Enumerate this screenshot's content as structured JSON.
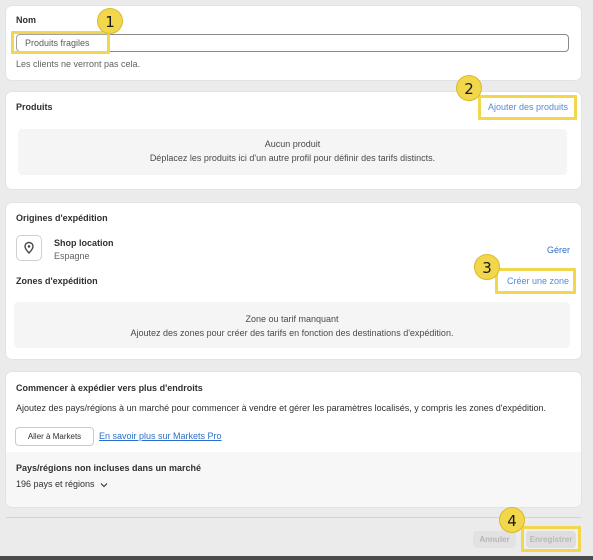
{
  "name_section": {
    "label": "Nom",
    "value": "Produits fragiles",
    "help": "Les clients ne verront pas cela."
  },
  "products_section": {
    "title": "Produits",
    "add_link": "Ajouter des produits",
    "empty_title": "Aucun produit",
    "empty_desc": "Déplacez les produits ici d'un autre profil pour définir des tarifs distincts."
  },
  "shipping_section": {
    "origins_title": "Origines d'expédition",
    "location_name": "Shop location",
    "location_country": "Espagne",
    "manage_link": "Gérer",
    "zones_title": "Zones d'expédition",
    "create_zone_link": "Créer une zone",
    "empty_title": "Zone ou tarif manquant",
    "empty_desc": "Ajoutez des zones pour créer des tarifs en fonction des destinations d'expédition."
  },
  "markets_section": {
    "title": "Commencer à expédier vers plus d'endroits",
    "desc": "Ajoutez des pays/régions à un marché pour commencer à vendre et gérer les paramètres localisés, y compris les zones d'expédition.",
    "go_button": "Aller à Markets",
    "learn_link": "En savoir plus sur Markets Pro",
    "excluded_title": "Pays/régions non incluses dans un marché",
    "excluded_count": "196 pays et régions"
  },
  "footer": {
    "cancel_label": "Annuler",
    "save_label": "Enregistrer"
  },
  "annotations": [
    "1",
    "2",
    "3",
    "4"
  ],
  "colors": {
    "highlight": "#f2d64b",
    "link": "#2c6ecb",
    "background": "#ebebeb"
  }
}
